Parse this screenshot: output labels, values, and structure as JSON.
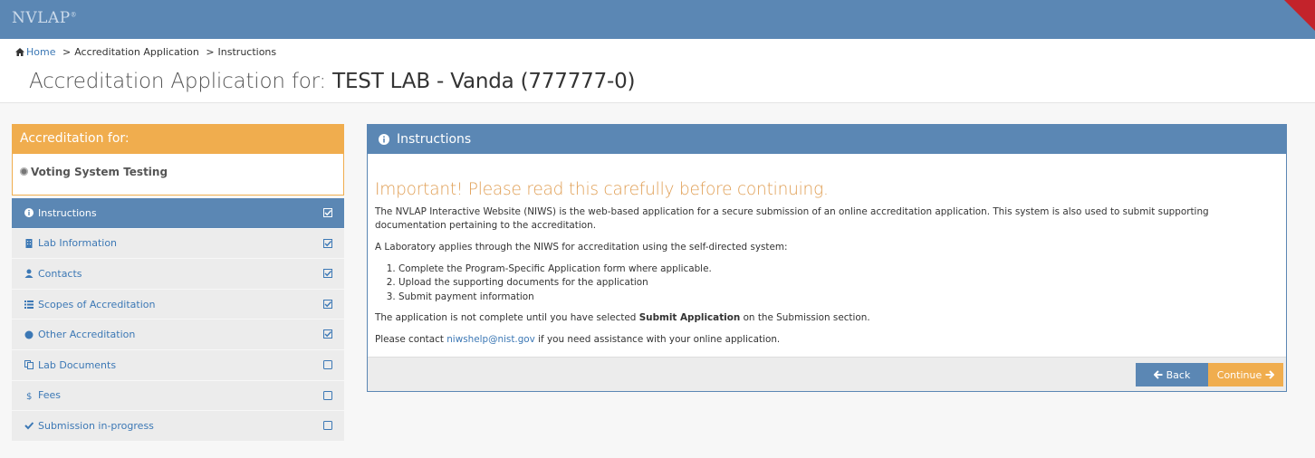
{
  "header": {
    "logo": "NVLAP",
    "logo_mark": "®"
  },
  "breadcrumb": {
    "home": "Home",
    "sep": ">",
    "items": [
      "Accreditation Application",
      "Instructions"
    ]
  },
  "title": {
    "prefix": "Accreditation Application for:",
    "lab": "TEST LAB - Vanda (777777-0)"
  },
  "accreditation": {
    "heading": "Accreditation for:",
    "program": "Voting System Testing"
  },
  "menu": [
    {
      "label": "Instructions",
      "icon": "info-icon",
      "checked": true,
      "active": true
    },
    {
      "label": "Lab Information",
      "icon": "building-icon",
      "checked": true
    },
    {
      "label": "Contacts",
      "icon": "user-icon",
      "checked": true
    },
    {
      "label": "Scopes of Accreditation",
      "icon": "list-icon",
      "checked": true
    },
    {
      "label": "Other Accreditation",
      "icon": "circle-icon",
      "checked": true
    },
    {
      "label": "Lab Documents",
      "icon": "copy-icon",
      "checked": false
    },
    {
      "label": "Fees",
      "icon": "dollar-icon",
      "checked": false
    },
    {
      "label": "Submission in-progress",
      "icon": "check-icon",
      "checked": false
    }
  ],
  "panel": {
    "heading": "Instructions",
    "warning": "Important! Please read this carefully before continuing.",
    "para1": "The NVLAP Interactive Website (NIWS) is the web-based application for a secure submission of an online accreditation application. This system is also used to submit supporting documentation pertaining to the accreditation.",
    "para2": "A Laboratory applies through the NIWS for accreditation using the self-directed system:",
    "steps": [
      "Complete the Program-Specific Application form where applicable.",
      "Upload the supporting documents for the application",
      "Submit payment information"
    ],
    "para3_pre": "The application is not complete until you have selected ",
    "para3_bold": "Submit Application",
    "para3_post": " on the Submission section.",
    "para4_pre": "Please contact ",
    "para4_link": "niwshelp@nist.gov",
    "para4_post": " if you need assistance with your online application.",
    "back_label": "Back",
    "continue_label": "Continue"
  },
  "colors": {
    "primary": "#5b87b4",
    "accent": "#f0ad4e",
    "link": "#3c78b5",
    "warning_text": "#e09f55"
  }
}
